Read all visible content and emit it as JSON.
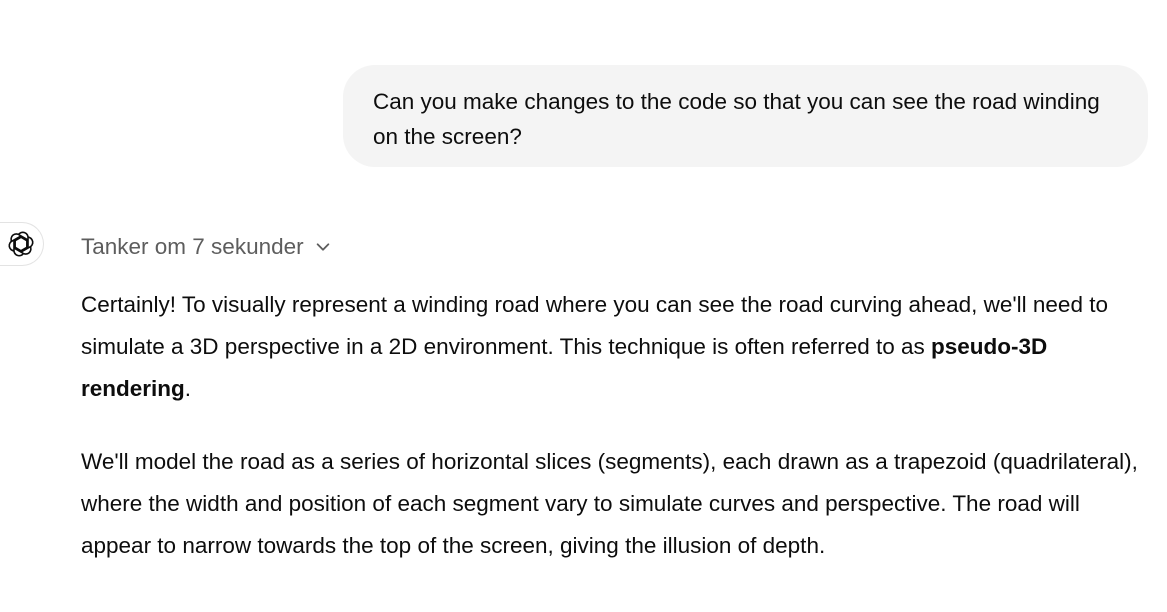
{
  "user_message": {
    "text": "Can you make changes to the code so that you can see the road winding on the screen?"
  },
  "assistant": {
    "avatar_icon": "chatgpt-logo-icon",
    "thought_label": "Tanker om 7 sekunder",
    "thought_icon": "chevron-down-icon",
    "paragraph1": {
      "before": "Certainly! To visually represent a winding road where you can see the road curving ahead, we'll need to simulate a 3D perspective in a 2D environment. This technique is often referred to as ",
      "bold": "pseudo-3D rendering",
      "after": "."
    },
    "paragraph2": "We'll model the road as a series of horizontal slices (segments), each drawn as a trapezoid (quadrilateral), where the width and position of each segment vary to simulate curves and perspective. The road will appear to narrow towards the top of the screen, giving the illusion of depth."
  }
}
